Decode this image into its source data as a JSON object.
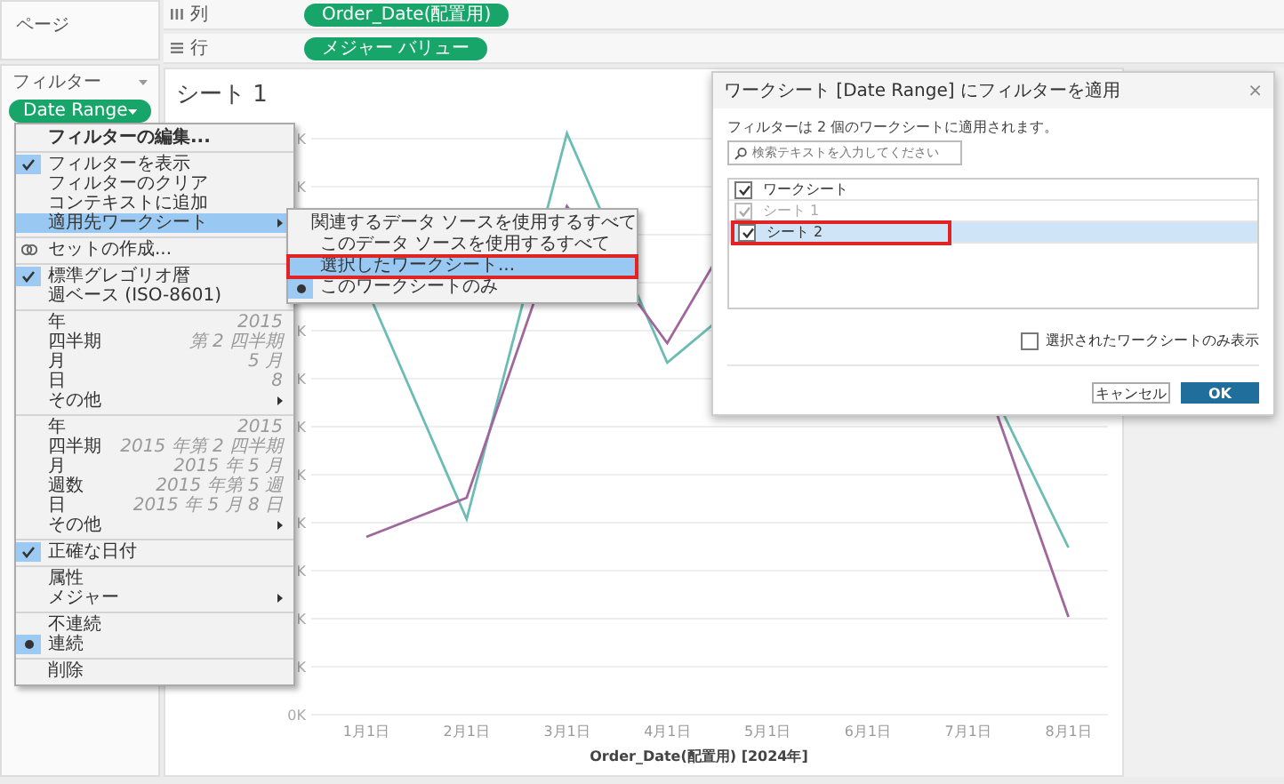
{
  "left_panel": {
    "pages_label": "ページ",
    "filters_label": "フィルター",
    "filter_pill": "Date Range"
  },
  "shelves": [
    {
      "kind": "columns",
      "label": "列",
      "pill": "Order_Date(配置用)"
    },
    {
      "kind": "rows",
      "label": "行",
      "pill": "メジャー バリュー"
    }
  ],
  "sheet": {
    "title": "シート 1",
    "y_tick_labels": [
      "K",
      "K",
      "K",
      "K",
      "K",
      "K",
      "K",
      "K",
      "K",
      "K",
      "0K"
    ],
    "x_labels": [
      "1月1日",
      "2月1日",
      "3月1日",
      "4月1日",
      "5月1日",
      "6月1日",
      "7月1日",
      "8月1日"
    ],
    "x_title": "Order_Date(配置用) [2024年]"
  },
  "context_menu": {
    "items": [
      {
        "kind": "default",
        "label": "フィルターの編集...",
        "checked": false,
        "highlighted": false
      },
      {
        "kind": "separator"
      },
      {
        "kind": "command",
        "label": "フィルターを表示",
        "checked": true,
        "highlighted": false
      },
      {
        "kind": "command",
        "label": "フィルターのクリア",
        "checked": false,
        "highlighted": false
      },
      {
        "kind": "command",
        "label": "コンテキストに追加",
        "checked": false,
        "highlighted": false
      },
      {
        "kind": "submenu",
        "label": "適用先ワークシート",
        "checked": false,
        "highlighted": true
      },
      {
        "kind": "separator"
      },
      {
        "kind": "set",
        "label": "セットの作成...",
        "checked": false,
        "highlighted": false
      },
      {
        "kind": "separator"
      },
      {
        "kind": "command",
        "label": "標準グレゴリオ暦",
        "checked": true,
        "highlighted": false
      },
      {
        "kind": "command",
        "label": "週ベース (ISO-8601)",
        "checked": false,
        "highlighted": false
      },
      {
        "kind": "separator"
      },
      {
        "kind": "command",
        "label": "年",
        "value": "2015",
        "checked": false,
        "highlighted": false
      },
      {
        "kind": "command",
        "label": "四半期",
        "value": "第 2 四半期",
        "checked": false,
        "highlighted": false
      },
      {
        "kind": "command",
        "label": "月",
        "value": "5 月",
        "checked": false,
        "highlighted": false
      },
      {
        "kind": "command",
        "label": "日",
        "value": "8",
        "checked": false,
        "highlighted": false
      },
      {
        "kind": "submenu",
        "label": "その他",
        "checked": false,
        "highlighted": false
      },
      {
        "kind": "separator"
      },
      {
        "kind": "command",
        "label": "年",
        "value": "2015",
        "checked": false,
        "highlighted": false
      },
      {
        "kind": "command",
        "label": "四半期",
        "value": "2015 年第 2 四半期",
        "checked": false,
        "highlighted": false
      },
      {
        "kind": "command",
        "label": "月",
        "value": "2015 年 5 月",
        "checked": false,
        "highlighted": false
      },
      {
        "kind": "command",
        "label": "週数",
        "value": "2015 年第 5 週",
        "checked": false,
        "highlighted": false
      },
      {
        "kind": "command",
        "label": "日",
        "value": "2015 年 5 月 8 日",
        "checked": false,
        "highlighted": false
      },
      {
        "kind": "submenu",
        "label": "その他",
        "checked": false,
        "highlighted": false
      },
      {
        "kind": "separator"
      },
      {
        "kind": "command",
        "label": "正確な日付",
        "checked": true,
        "highlighted": false
      },
      {
        "kind": "separator"
      },
      {
        "kind": "command",
        "label": "属性",
        "checked": false,
        "highlighted": false
      },
      {
        "kind": "submenu",
        "label": "メジャー",
        "checked": false,
        "highlighted": false
      },
      {
        "kind": "separator"
      },
      {
        "kind": "radio",
        "label": "不連続",
        "checked": false,
        "highlighted": false
      },
      {
        "kind": "radio",
        "label": "連続",
        "checked": true,
        "highlighted": false
      },
      {
        "kind": "separator"
      },
      {
        "kind": "command",
        "label": "削除",
        "checked": false,
        "highlighted": false
      }
    ]
  },
  "submenu": {
    "items": [
      {
        "label": "関連するデータ ソースを使用するすべて",
        "checked": false,
        "highlighted": false,
        "outlined": false
      },
      {
        "label": "このデータ ソースを使用するすべて",
        "checked": false,
        "highlighted": false,
        "outlined": false
      },
      {
        "label": "選択したワークシート...",
        "checked": false,
        "highlighted": true,
        "outlined": true
      },
      {
        "label": "このワークシートのみ",
        "checked": true,
        "highlighted": false,
        "outlined": false
      }
    ]
  },
  "dialog": {
    "title": "ワークシート [Date Range] にフィルターを適用",
    "close": "×",
    "message": "フィルターは 2 個のワークシートに適用されます。",
    "search": {
      "placeholder": "検索テキストを入力してください"
    },
    "header": {
      "label": "ワークシート",
      "checked": true
    },
    "rows": [
      {
        "label": "シート 1",
        "checked": true,
        "disabled": true,
        "selected": false,
        "outlined": false
      },
      {
        "label": "シート 2",
        "checked": true,
        "disabled": false,
        "selected": true,
        "outlined": true
      }
    ],
    "only_selected": {
      "label": "選択されたワークシートのみ表示",
      "checked": false
    },
    "buttons": [
      {
        "kind": "secondary",
        "label": "キャンセル"
      },
      {
        "kind": "primary",
        "label": "OK"
      }
    ]
  }
}
